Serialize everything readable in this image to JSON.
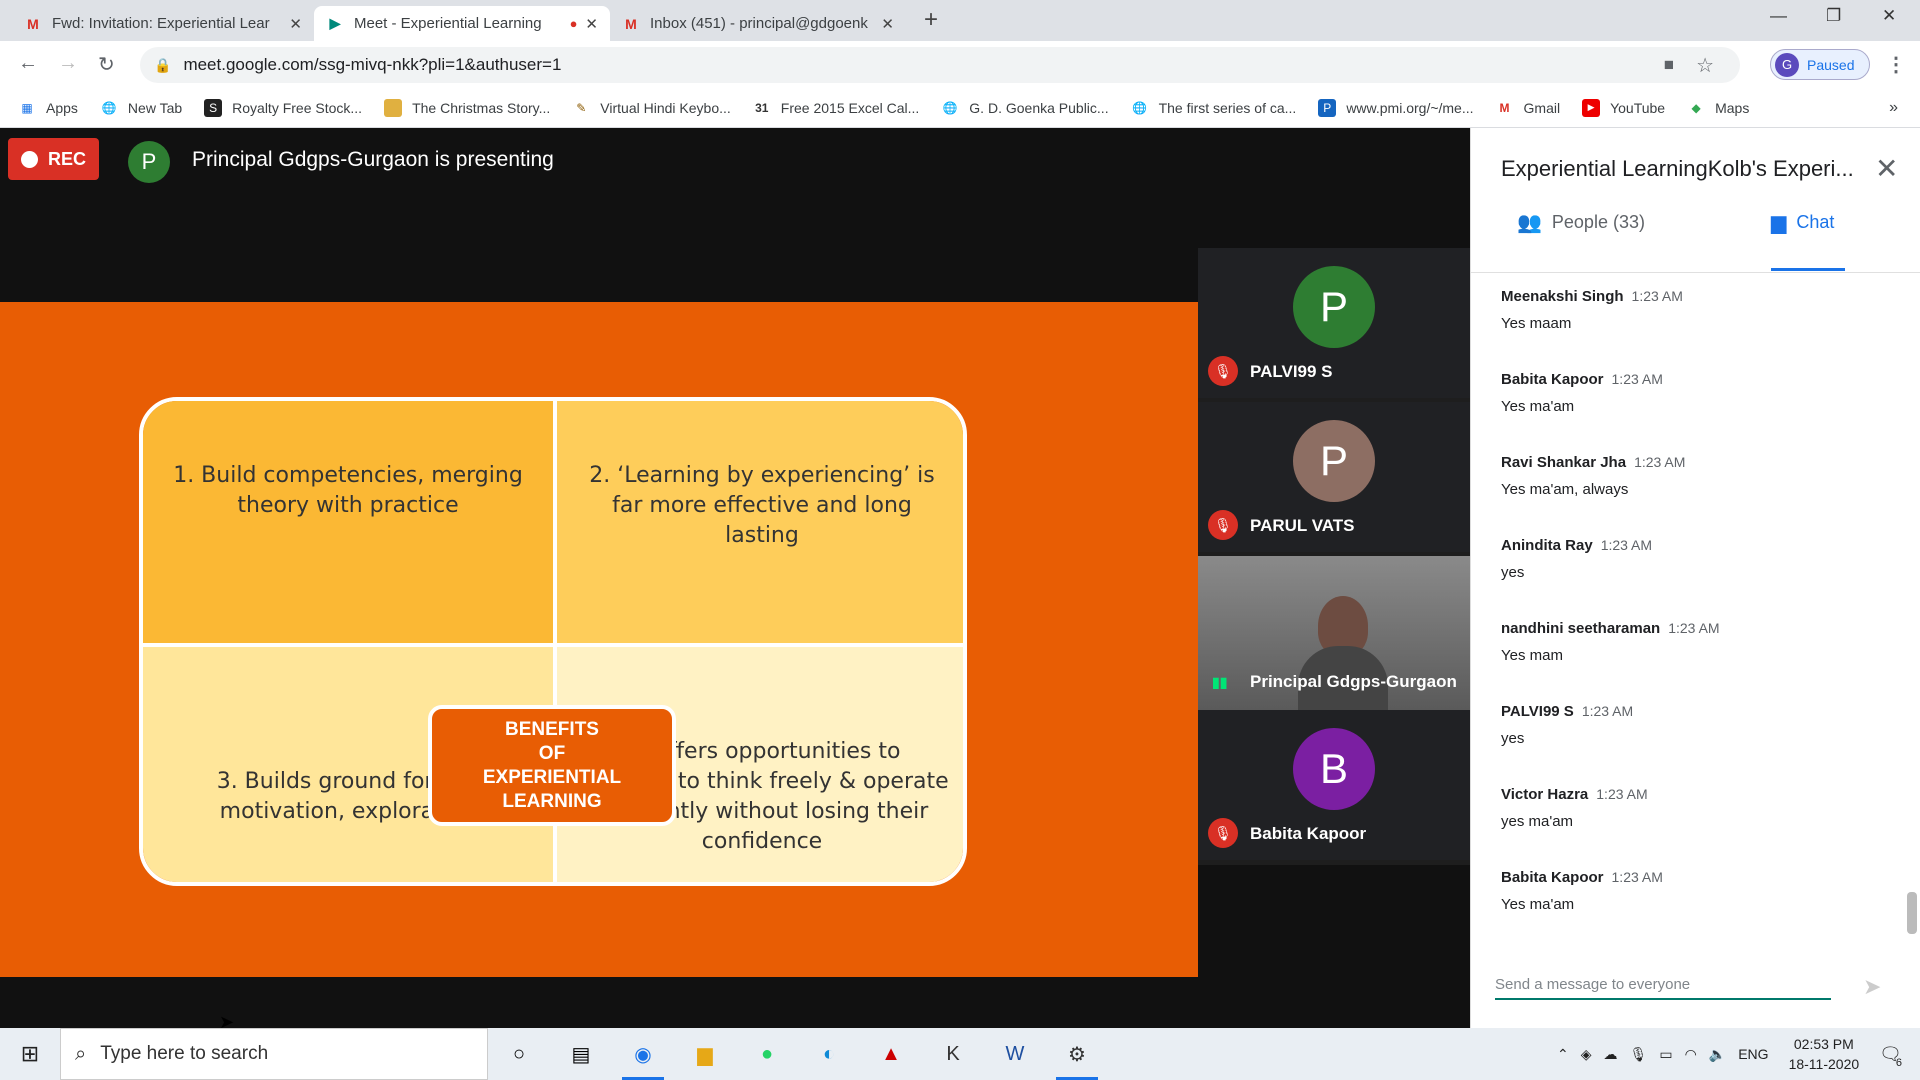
{
  "browser": {
    "tabs": [
      {
        "title": "Fwd: Invitation: Experiential Lear",
        "icon": "gmail-icon"
      },
      {
        "title": "Meet - Experiential Learning",
        "icon": "meet-icon"
      },
      {
        "title": "Inbox (451) - principal@gdgoenk",
        "icon": "gmail-icon"
      }
    ],
    "url": "meet.google.com/ssg-mivq-nkk?pli=1&authuser=1",
    "profile_initial": "G",
    "profile_status": "Paused",
    "bookmarks": [
      "Apps",
      "New Tab",
      "Royalty Free Stock...",
      "The Christmas Story...",
      "Virtual Hindi Keybo...",
      "Free 2015 Excel Cal...",
      "G. D. Goenka Public...",
      "The first series of ca...",
      "www.pmi.org/~/me...",
      "Gmail",
      "YouTube",
      "Maps"
    ],
    "more_bookmarks": "»"
  },
  "meet": {
    "rec_label": "REC",
    "presenter_initial": "P",
    "presenting_text": "Principal Gdgps-Gurgaon is presenting",
    "slide": {
      "center": [
        "BENEFITS",
        "OF",
        "EXPERIENTIAL",
        "LEARNING"
      ],
      "q1": "1. Build competencies, merging theory with practice",
      "q2": "2. ‘Learning by experiencing’ is far more effective and long lasting",
      "q3": "3. Builds ground for self motivation, exploration",
      "q4": "4. Offers opportunities to students to think freely & operate differently without losing their confidence"
    },
    "participants": [
      {
        "initial": "P",
        "name": "PALVI99 S",
        "color": "#2e7d32"
      },
      {
        "initial": "P",
        "name": "PARUL VATS",
        "color": "#8d6e63"
      },
      {
        "initial": "",
        "name": "Principal Gdgps-Gurgaon",
        "color": ""
      },
      {
        "initial": "B",
        "name": "Babita Kapoor",
        "color": "#7b1fa2"
      }
    ]
  },
  "panel": {
    "title": "Experiential LearningKolb's Experi...",
    "people_tab": "People (33)",
    "chat_tab": "Chat",
    "messages": [
      {
        "who": "Meenakshi Singh",
        "time": "1:23 AM",
        "text": "Yes maam"
      },
      {
        "who": "Babita Kapoor",
        "time": "1:23 AM",
        "text": "Yes ma'am"
      },
      {
        "who": "Ravi Shankar Jha",
        "time": "1:23 AM",
        "text": "Yes ma'am, always"
      },
      {
        "who": "Anindita Ray",
        "time": "1:23 AM",
        "text": "yes"
      },
      {
        "who": "nandhini seetharaman",
        "time": "1:23 AM",
        "text": "Yes mam"
      },
      {
        "who": "PALVI99 S",
        "time": "1:23 AM",
        "text": "yes"
      },
      {
        "who": "Victor Hazra",
        "time": "1:23 AM",
        "text": "yes ma'am"
      },
      {
        "who": "Babita Kapoor",
        "time": "1:23 AM",
        "text": "Yes ma'am"
      }
    ],
    "input_placeholder": "Send a message to everyone"
  },
  "taskbar": {
    "search_placeholder": "Type here to search",
    "lang": "ENG",
    "time": "02:53 PM",
    "date": "18-11-2020",
    "notif_count": "6"
  }
}
